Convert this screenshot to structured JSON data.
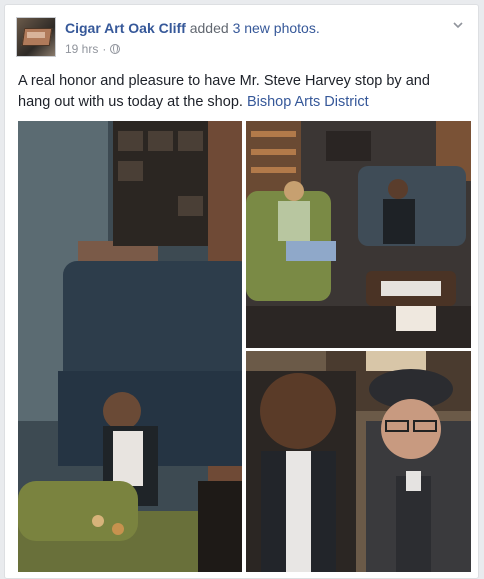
{
  "post": {
    "page_name": "Cigar Art Oak Cliff",
    "action_prefix": "added",
    "action_link": "3 new photos.",
    "timestamp": "19 hrs",
    "separator": "·",
    "text": "A real honor and pleasure to have Mr. Steve Harvey stop by and hang out with us today at the shop.",
    "tag": "Bishop Arts District"
  },
  "icons": {
    "privacy": "globe-icon",
    "menu": "chevron-down-icon"
  },
  "photos": [
    {
      "name": "photo-1"
    },
    {
      "name": "photo-2"
    },
    {
      "name": "photo-3"
    }
  ],
  "colors": {
    "link": "#365899",
    "meta": "#90949c",
    "text": "#1d2129",
    "feed_bg": "#e9ebee"
  }
}
